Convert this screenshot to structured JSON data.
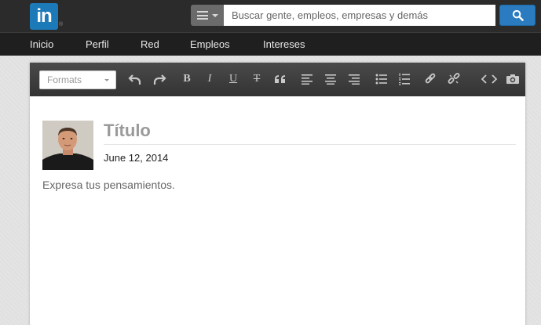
{
  "header": {
    "logo_text": "in",
    "logo_reg": "®",
    "search": {
      "placeholder": "Buscar gente, empleos, empresas y demás",
      "category_icon": "menu-list-icon",
      "button_icon": "search-icon"
    }
  },
  "nav": {
    "items": [
      {
        "label": "Inicio"
      },
      {
        "label": "Perfil"
      },
      {
        "label": "Red"
      },
      {
        "label": "Empleos"
      },
      {
        "label": "Intereses"
      }
    ]
  },
  "toolbar": {
    "formats_label": "Formats",
    "bold": "B",
    "italic": "I",
    "underline": "U",
    "strike": "T"
  },
  "post": {
    "title": "Título",
    "date": "June 12, 2014",
    "body_placeholder": "Expresa tus pensamientos."
  },
  "colors": {
    "brand": "#1d7ab8",
    "topbar": "#2b2b2b",
    "search_button": "#2a7bc0"
  }
}
